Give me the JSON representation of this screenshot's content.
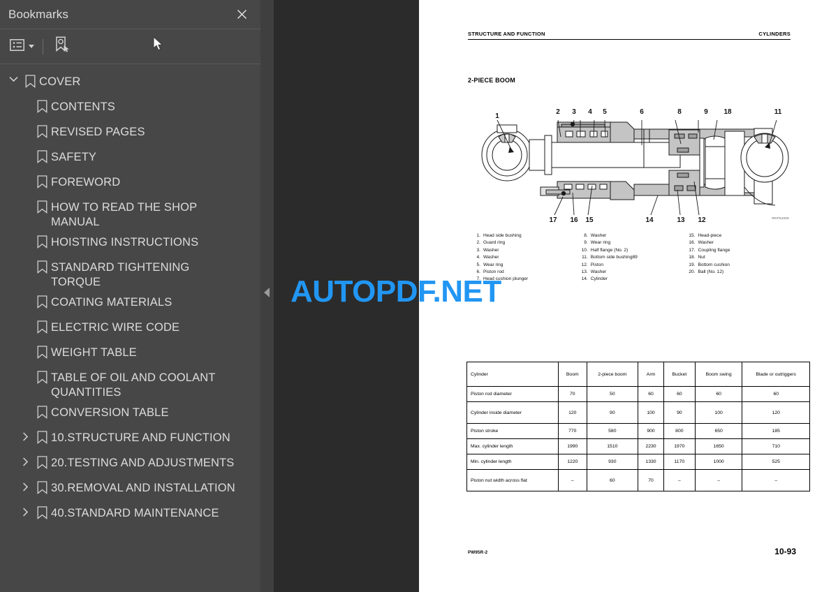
{
  "sidebar": {
    "title": "Bookmarks",
    "close_icon": "close-icon",
    "toolbar": {
      "list_options_icon": "list-options-icon",
      "dropdown_caret_icon": "chevron-down-icon",
      "new_bookmark_icon": "new-bookmark-icon"
    },
    "items": [
      {
        "label": "COVER",
        "level": 0,
        "expanded": true,
        "has_children": true
      },
      {
        "label": "CONTENTS",
        "level": 1,
        "has_children": false
      },
      {
        "label": "REVISED PAGES",
        "level": 1,
        "has_children": false
      },
      {
        "label": "SAFETY",
        "level": 1,
        "has_children": false
      },
      {
        "label": "FOREWORD",
        "level": 1,
        "has_children": false
      },
      {
        "label": "HOW TO READ THE SHOP MANUAL",
        "level": 1,
        "has_children": false
      },
      {
        "label": "HOISTING INSTRUCTIONS",
        "level": 1,
        "has_children": false
      },
      {
        "label": "STANDARD TIGHTENING TORQUE",
        "level": 1,
        "has_children": false
      },
      {
        "label": "COATING MATERIALS",
        "level": 1,
        "has_children": false
      },
      {
        "label": "ELECTRIC WIRE CODE",
        "level": 1,
        "has_children": false
      },
      {
        "label": "WEIGHT TABLE",
        "level": 1,
        "has_children": false
      },
      {
        "label": "TABLE OF OIL AND COOLANT QUANTITIES",
        "level": 1,
        "has_children": false
      },
      {
        "label": "CONVERSION TABLE",
        "level": 1,
        "has_children": false
      },
      {
        "label": "10.STRUCTURE AND FUNCTION",
        "level": 1,
        "has_children": true,
        "expanded": false
      },
      {
        "label": "20.TESTING AND ADJUSTMENTS",
        "level": 1,
        "has_children": true,
        "expanded": false
      },
      {
        "label": "30.REMOVAL AND INSTALLATION",
        "level": 1,
        "has_children": true,
        "expanded": false
      },
      {
        "label": "40.STANDARD MAINTENANCE",
        "level": 1,
        "has_children": true,
        "expanded": false
      }
    ]
  },
  "viewer": {
    "collapse_arrow_icon": "collapse-sidebar-arrow-icon",
    "watermark": "AUTOPDF.NET",
    "watermark_color": "#2196f3"
  },
  "page": {
    "header_left": "STRUCTURE AND FUNCTION",
    "header_right": "CYLINDERS",
    "section_title": "2-PIECE BOOM",
    "figure_code": "RKP04330",
    "callouts_top": [
      "1",
      "2",
      "3",
      "4",
      "5",
      "6",
      "8",
      "9",
      "18",
      "11"
    ],
    "callouts_bottom": [
      "17",
      "16",
      "15",
      "14",
      "13",
      "12"
    ],
    "legend": {
      "col1": [
        {
          "num": "1.",
          "text": "Head side bushing"
        },
        {
          "num": "2.",
          "text": "Guard ring"
        },
        {
          "num": "3.",
          "text": "Washer"
        },
        {
          "num": "4.",
          "text": "Washer"
        },
        {
          "num": "5.",
          "text": "Wear ring"
        },
        {
          "num": "6.",
          "text": "Piston rod"
        },
        {
          "num": "7.",
          "text": "Head cushion plunger"
        }
      ],
      "col2": [
        {
          "num": "8.",
          "text": "Washer"
        },
        {
          "num": "9.",
          "text": "Wear ring"
        },
        {
          "num": "10.",
          "text": "Half flange (No. 2)"
        },
        {
          "num": "11.",
          "text": "Bottom side bushing89"
        },
        {
          "num": "12.",
          "text": "Piston"
        },
        {
          "num": "13.",
          "text": "Washer"
        },
        {
          "num": "14.",
          "text": "Cylinder"
        }
      ],
      "col3": [
        {
          "num": "15.",
          "text": "Head-piece"
        },
        {
          "num": "16.",
          "text": "Washer"
        },
        {
          "num": "17.",
          "text": "Coupling flange"
        },
        {
          "num": "18.",
          "text": "Nut"
        },
        {
          "num": "19.",
          "text": "Bottom cushion"
        },
        {
          "num": "20.",
          "text": "Ball (No. 12)"
        }
      ]
    },
    "table": {
      "columns": [
        "Cylinder",
        "Boom",
        "2-piece boom",
        "Arm",
        "Bucket",
        "Boom swing",
        "Blade or outriggers"
      ],
      "rows": [
        {
          "label": "Piston rod diameter",
          "values": [
            "70",
            "50",
            "60",
            "60",
            "60",
            "60"
          ]
        },
        {
          "label": "Cylinder inside diameter",
          "values": [
            "120",
            "90",
            "100",
            "90",
            "100",
            "120"
          ]
        },
        {
          "label": "Piston stroke",
          "values": [
            "770",
            "580",
            "900",
            "800",
            "650",
            "185"
          ]
        },
        {
          "label": "Max. cylinder length",
          "values": [
            "1990",
            "1510",
            "2230",
            "1970",
            "1650",
            "710"
          ]
        },
        {
          "label": "Min. cylinder length",
          "values": [
            "1220",
            "930",
            "1330",
            "1170",
            "1000",
            "525"
          ]
        },
        {
          "label": "Piston nut width across flat",
          "values": [
            "–",
            "60",
            "70",
            "–",
            "–",
            "–"
          ]
        }
      ]
    },
    "footer_left": "PW95R-2",
    "footer_right": "10-93"
  }
}
